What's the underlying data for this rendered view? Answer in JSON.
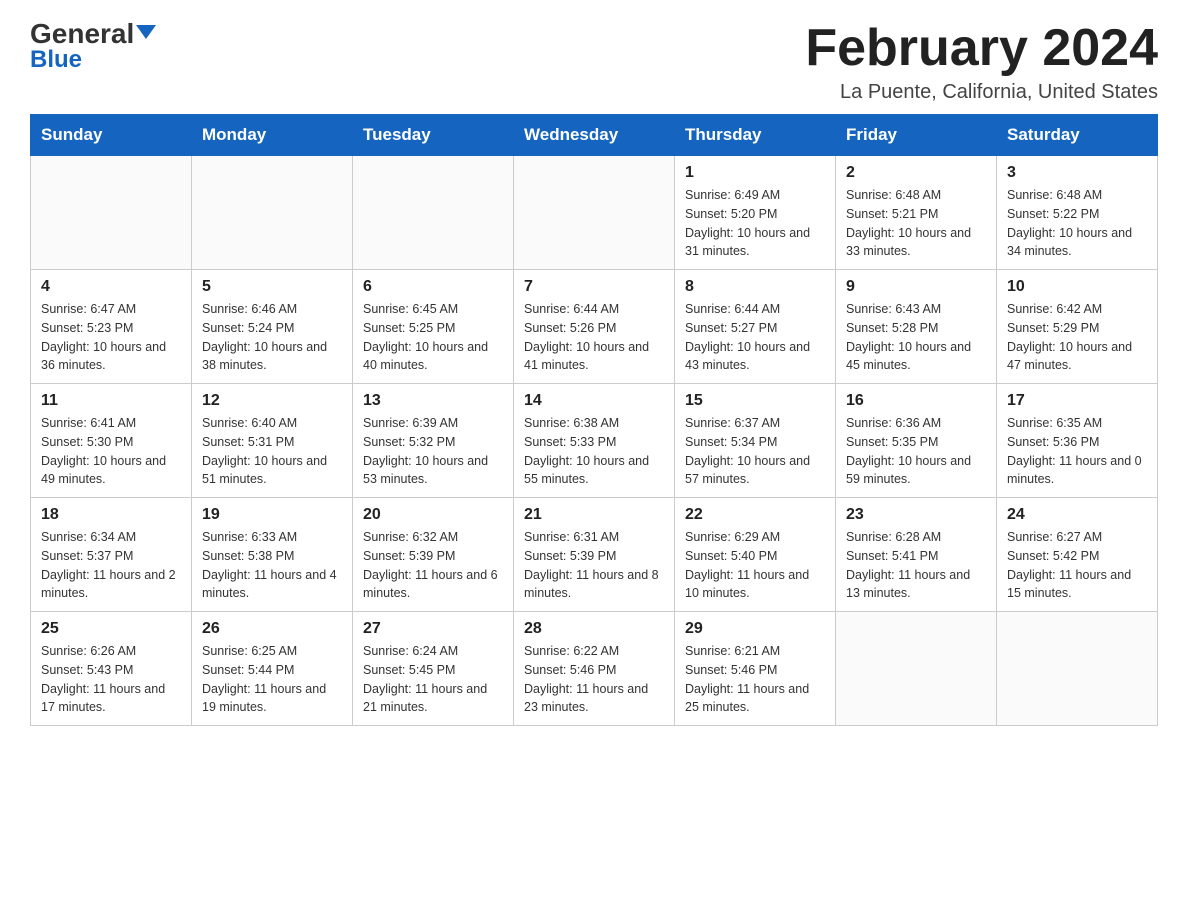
{
  "header": {
    "logo_general": "General",
    "logo_blue": "Blue",
    "month_title": "February 2024",
    "location": "La Puente, California, United States"
  },
  "days_of_week": [
    "Sunday",
    "Monday",
    "Tuesday",
    "Wednesday",
    "Thursday",
    "Friday",
    "Saturday"
  ],
  "weeks": [
    [
      {
        "day": "",
        "info": ""
      },
      {
        "day": "",
        "info": ""
      },
      {
        "day": "",
        "info": ""
      },
      {
        "day": "",
        "info": ""
      },
      {
        "day": "1",
        "info": "Sunrise: 6:49 AM\nSunset: 5:20 PM\nDaylight: 10 hours and 31 minutes."
      },
      {
        "day": "2",
        "info": "Sunrise: 6:48 AM\nSunset: 5:21 PM\nDaylight: 10 hours and 33 minutes."
      },
      {
        "day": "3",
        "info": "Sunrise: 6:48 AM\nSunset: 5:22 PM\nDaylight: 10 hours and 34 minutes."
      }
    ],
    [
      {
        "day": "4",
        "info": "Sunrise: 6:47 AM\nSunset: 5:23 PM\nDaylight: 10 hours and 36 minutes."
      },
      {
        "day": "5",
        "info": "Sunrise: 6:46 AM\nSunset: 5:24 PM\nDaylight: 10 hours and 38 minutes."
      },
      {
        "day": "6",
        "info": "Sunrise: 6:45 AM\nSunset: 5:25 PM\nDaylight: 10 hours and 40 minutes."
      },
      {
        "day": "7",
        "info": "Sunrise: 6:44 AM\nSunset: 5:26 PM\nDaylight: 10 hours and 41 minutes."
      },
      {
        "day": "8",
        "info": "Sunrise: 6:44 AM\nSunset: 5:27 PM\nDaylight: 10 hours and 43 minutes."
      },
      {
        "day": "9",
        "info": "Sunrise: 6:43 AM\nSunset: 5:28 PM\nDaylight: 10 hours and 45 minutes."
      },
      {
        "day": "10",
        "info": "Sunrise: 6:42 AM\nSunset: 5:29 PM\nDaylight: 10 hours and 47 minutes."
      }
    ],
    [
      {
        "day": "11",
        "info": "Sunrise: 6:41 AM\nSunset: 5:30 PM\nDaylight: 10 hours and 49 minutes."
      },
      {
        "day": "12",
        "info": "Sunrise: 6:40 AM\nSunset: 5:31 PM\nDaylight: 10 hours and 51 minutes."
      },
      {
        "day": "13",
        "info": "Sunrise: 6:39 AM\nSunset: 5:32 PM\nDaylight: 10 hours and 53 minutes."
      },
      {
        "day": "14",
        "info": "Sunrise: 6:38 AM\nSunset: 5:33 PM\nDaylight: 10 hours and 55 minutes."
      },
      {
        "day": "15",
        "info": "Sunrise: 6:37 AM\nSunset: 5:34 PM\nDaylight: 10 hours and 57 minutes."
      },
      {
        "day": "16",
        "info": "Sunrise: 6:36 AM\nSunset: 5:35 PM\nDaylight: 10 hours and 59 minutes."
      },
      {
        "day": "17",
        "info": "Sunrise: 6:35 AM\nSunset: 5:36 PM\nDaylight: 11 hours and 0 minutes."
      }
    ],
    [
      {
        "day": "18",
        "info": "Sunrise: 6:34 AM\nSunset: 5:37 PM\nDaylight: 11 hours and 2 minutes."
      },
      {
        "day": "19",
        "info": "Sunrise: 6:33 AM\nSunset: 5:38 PM\nDaylight: 11 hours and 4 minutes."
      },
      {
        "day": "20",
        "info": "Sunrise: 6:32 AM\nSunset: 5:39 PM\nDaylight: 11 hours and 6 minutes."
      },
      {
        "day": "21",
        "info": "Sunrise: 6:31 AM\nSunset: 5:39 PM\nDaylight: 11 hours and 8 minutes."
      },
      {
        "day": "22",
        "info": "Sunrise: 6:29 AM\nSunset: 5:40 PM\nDaylight: 11 hours and 10 minutes."
      },
      {
        "day": "23",
        "info": "Sunrise: 6:28 AM\nSunset: 5:41 PM\nDaylight: 11 hours and 13 minutes."
      },
      {
        "day": "24",
        "info": "Sunrise: 6:27 AM\nSunset: 5:42 PM\nDaylight: 11 hours and 15 minutes."
      }
    ],
    [
      {
        "day": "25",
        "info": "Sunrise: 6:26 AM\nSunset: 5:43 PM\nDaylight: 11 hours and 17 minutes."
      },
      {
        "day": "26",
        "info": "Sunrise: 6:25 AM\nSunset: 5:44 PM\nDaylight: 11 hours and 19 minutes."
      },
      {
        "day": "27",
        "info": "Sunrise: 6:24 AM\nSunset: 5:45 PM\nDaylight: 11 hours and 21 minutes."
      },
      {
        "day": "28",
        "info": "Sunrise: 6:22 AM\nSunset: 5:46 PM\nDaylight: 11 hours and 23 minutes."
      },
      {
        "day": "29",
        "info": "Sunrise: 6:21 AM\nSunset: 5:46 PM\nDaylight: 11 hours and 25 minutes."
      },
      {
        "day": "",
        "info": ""
      },
      {
        "day": "",
        "info": ""
      }
    ]
  ]
}
